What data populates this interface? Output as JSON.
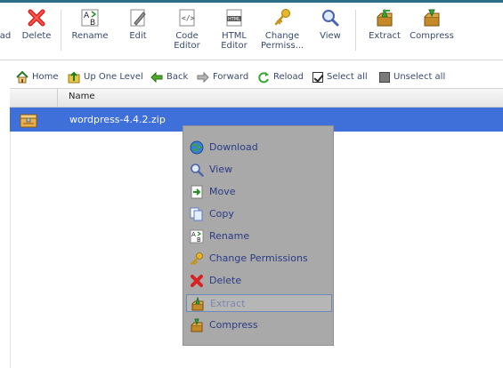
{
  "toolbar": {
    "items": [
      {
        "label": "ad",
        "icon": "upload-icon"
      },
      {
        "label": "Delete",
        "icon": "delete-x-icon"
      },
      {
        "label": "Rename",
        "icon": "rename-ab-icon"
      },
      {
        "label": "Edit",
        "icon": "edit-pencil-icon"
      },
      {
        "label": "Code\nEditor",
        "icon": "code-editor-icon"
      },
      {
        "label": "HTML\nEditor",
        "icon": "html-editor-icon"
      },
      {
        "label": "Change\nPermiss...",
        "icon": "key-icon"
      },
      {
        "label": "View",
        "icon": "magnifier-icon"
      },
      {
        "label": "Extract",
        "icon": "extract-box-icon"
      },
      {
        "label": "Compress",
        "icon": "compress-box-icon"
      }
    ]
  },
  "navbar": {
    "home": "Home",
    "up_one_level": "Up One Level",
    "back": "Back",
    "forward": "Forward",
    "reload": "Reload",
    "select_all": "Select all",
    "unselect_all": "Unselect all"
  },
  "table": {
    "header_name": "Name",
    "rows": [
      {
        "name": "wordpress-4.4.2.zip",
        "icon": "zip-archive-icon",
        "selected": true
      }
    ]
  },
  "context_menu": {
    "items": [
      {
        "label": "Download",
        "icon": "globe-download-icon"
      },
      {
        "label": "View",
        "icon": "magnifier-icon"
      },
      {
        "label": "Move",
        "icon": "move-arrow-icon"
      },
      {
        "label": "Copy",
        "icon": "copy-pages-icon"
      },
      {
        "label": "Rename",
        "icon": "rename-ab-icon"
      },
      {
        "label": "Change Permissions",
        "icon": "key-icon"
      },
      {
        "label": "Delete",
        "icon": "delete-x-icon"
      },
      {
        "label": "Extract",
        "icon": "extract-box-icon",
        "highlighted": true
      },
      {
        "label": "Compress",
        "icon": "compress-box-icon"
      }
    ]
  },
  "colors": {
    "selection": "#3f6fd9",
    "menu_bg": "#a9a9a9",
    "menu_text": "#2d3a86",
    "toolbar_text": "#3a4a6c"
  }
}
